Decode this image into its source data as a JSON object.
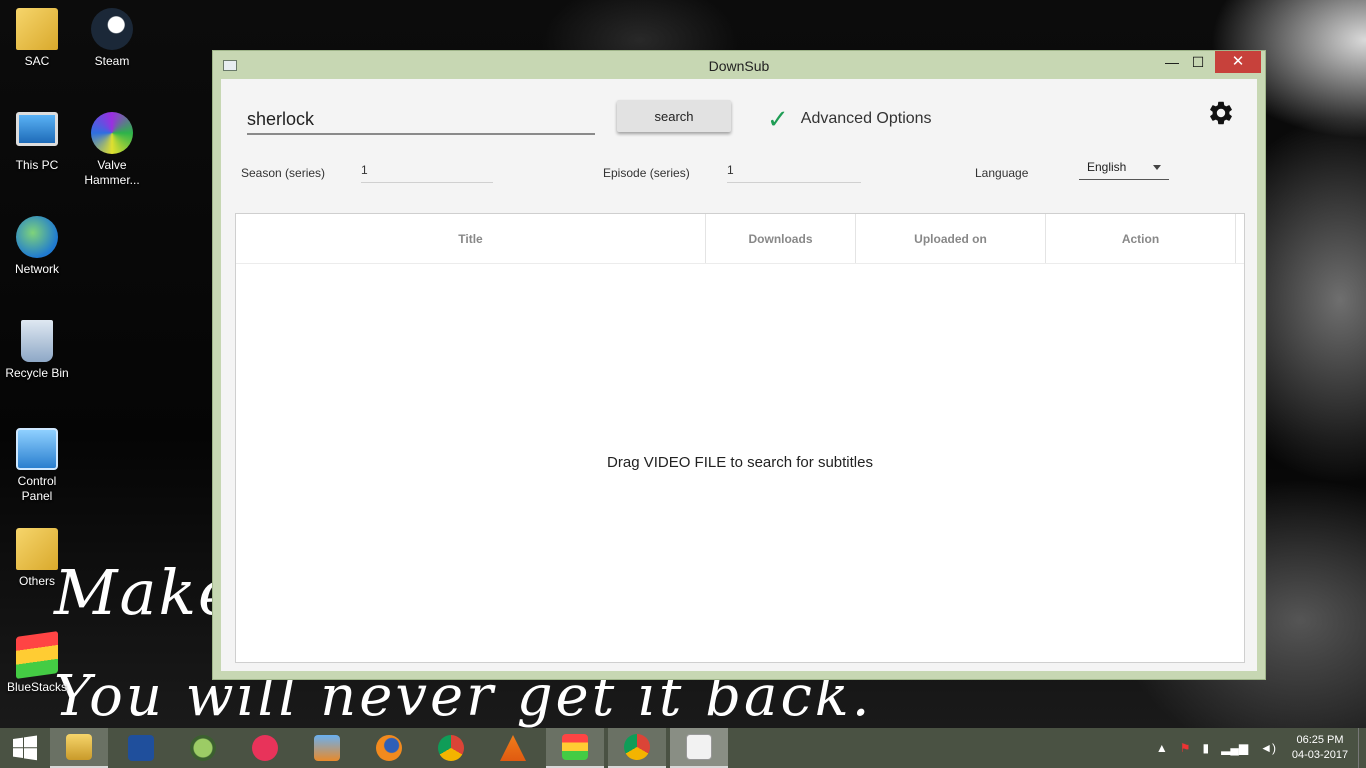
{
  "desktop": {
    "icons": [
      {
        "label": "SAC"
      },
      {
        "label": "Steam"
      },
      {
        "label": "This PC"
      },
      {
        "label": "Valve Hammer..."
      },
      {
        "label": "Network"
      },
      {
        "label": "Recycle Bin"
      },
      {
        "label": "Control Panel"
      },
      {
        "label": "Others"
      },
      {
        "label": "BlueStacks"
      }
    ],
    "wallpaper_text_1": "Make",
    "wallpaper_text_2": "You  will never get it back."
  },
  "window": {
    "title": "DownSub",
    "minimize": "—",
    "maximize": "☐",
    "close": "✕"
  },
  "toolbar": {
    "search_value": "sherlock",
    "search_button": "search",
    "advanced_check": "✓",
    "advanced_label": "Advanced Options"
  },
  "filters": {
    "season_label": "Season (series)",
    "season_value": "1",
    "episode_label": "Episode (series)",
    "episode_value": "1",
    "language_label": "Language",
    "language_value": "English"
  },
  "table": {
    "columns": [
      "Title",
      "Downloads",
      "Uploaded on",
      "Action"
    ],
    "empty_message": "Drag VIDEO FILE to search for subtitles"
  },
  "taskbar": {
    "time": "06:25 PM",
    "date": "04-03-2017"
  },
  "colors": {
    "window_frame": "#c7d7b3",
    "close_button": "#c7413b",
    "check_accent": "#1f9d55",
    "taskbar": "#4a5243"
  }
}
